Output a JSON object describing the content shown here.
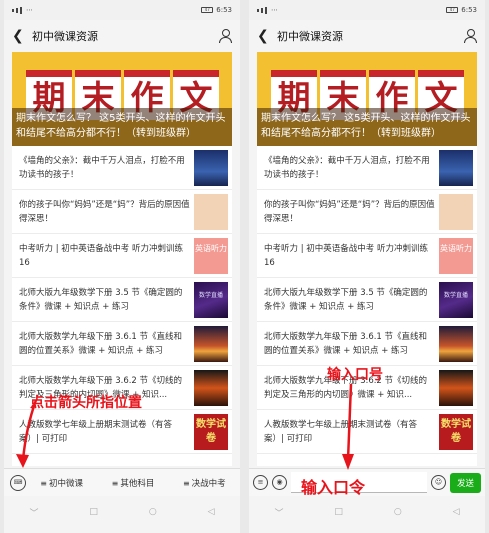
{
  "left_phone": {
    "status": {
      "time": "6:53",
      "battery": "47"
    },
    "title": "初中微课资源",
    "banner": {
      "chars": [
        "期",
        "末",
        "作",
        "文"
      ],
      "text": "期末作文怎么写？ 这5类开头、这样的作文开头和结尾不给高分都不行！（转到班级群）"
    },
    "items": [
      {
        "text": "《墙角的父亲》：截中千万人泪点，打脸不用功读书的孩子！",
        "thumb_text": ""
      },
      {
        "text": "你的孩子叫你“妈妈”还是“妈”？背后的原因值得深思！",
        "thumb_text": ""
      },
      {
        "text": "中考听力 | 初中英语备战中考 听力冲刺训练 16",
        "thumb_text": "英语听力"
      },
      {
        "text": "北师大版九年级数学下册 3.5 节《确定圆的条件》微课 + 知识点 + 练习",
        "thumb_text": "数学直播"
      },
      {
        "text": "北师大版数学九年级下册 3.6.1 节《直线和圆的位置关系》微课 + 知识点 + 练习",
        "thumb_text": ""
      },
      {
        "text": "北师大版数学九年级下册 3.6.2 节《切线的判定及三角形的内切圆》微课 + 知识...",
        "thumb_text": ""
      },
      {
        "text": "人教版数学七年级上册期末测试卷（有答案）| 可打印",
        "thumb_text": "数学试卷"
      }
    ],
    "menu": [
      "初中微课",
      "其他科目",
      "决战中考"
    ],
    "annotation": "点击箭头所指位置"
  },
  "right_phone": {
    "status": {
      "time": "6:53",
      "battery": "47"
    },
    "title": "初中微课资源",
    "send_label": "发送",
    "annotation_top": "输入口号",
    "annotation_bottom": "输入口令"
  },
  "colors": {
    "annotation": "#e8141c",
    "send": "#1aad19",
    "banner": "#f2c030"
  }
}
